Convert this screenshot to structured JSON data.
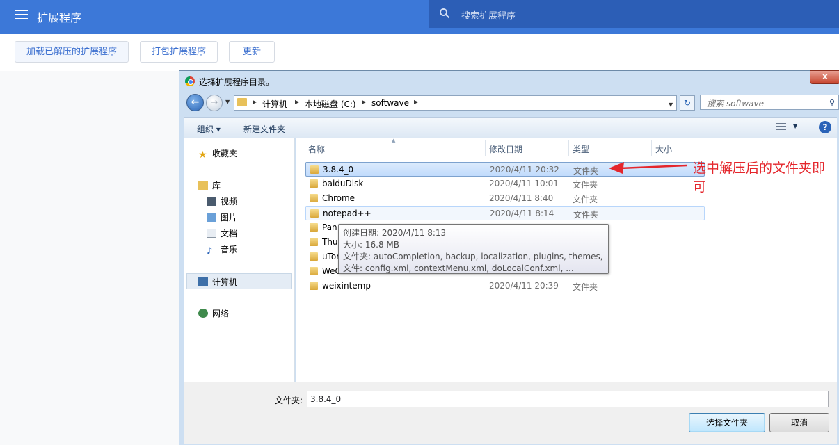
{
  "header": {
    "title": "扩展程序",
    "search_placeholder": "搜索扩展程序"
  },
  "toolbar": {
    "load_unpacked": "加载已解压的扩展程序",
    "pack": "打包扩展程序",
    "update": "更新"
  },
  "dialog": {
    "title": "选择扩展程序目录。",
    "close": "x",
    "breadcrumb": [
      "计算机",
      "本地磁盘 (C:)",
      "softwave"
    ],
    "search_placeholder": "搜索 softwave",
    "commands": {
      "organize": "组织 ▾",
      "new_folder": "新建文件夹"
    },
    "nav_pane": {
      "favorites": "收藏夹",
      "library": "库",
      "videos": "视频",
      "pictures": "图片",
      "documents": "文档",
      "music": "音乐",
      "computer": "计算机",
      "network": "网络"
    },
    "columns": {
      "name": "名称",
      "date": "修改日期",
      "type": "类型",
      "size": "大小"
    },
    "files": [
      {
        "name": "3.8.4_0",
        "date": "2020/4/11 20:32",
        "type": "文件夹"
      },
      {
        "name": "baiduDisk",
        "date": "2020/4/11 10:01",
        "type": "文件夹"
      },
      {
        "name": "Chrome",
        "date": "2020/4/11 8:40",
        "type": "文件夹"
      },
      {
        "name": "notepad++",
        "date": "2020/4/11 8:14",
        "type": "文件夹"
      },
      {
        "name": "Pan",
        "date": "",
        "type": ""
      },
      {
        "name": "Thu",
        "date": "",
        "type": ""
      },
      {
        "name": "uTor",
        "date": "",
        "type": ""
      },
      {
        "name": "WeC",
        "date": "",
        "type": ""
      },
      {
        "name": "weixintemp",
        "date": "2020/4/11 20:39",
        "type": "文件夹"
      }
    ],
    "tooltip": {
      "created": "创建日期: 2020/4/11 8:13",
      "size": "大小: 16.8 MB",
      "folders": "文件夹: autoCompletion, backup, localization, plugins, themes, ...",
      "files": "文件: config.xml, contextMenu.xml, doLocalConf.xml, ..."
    },
    "footer": {
      "folder_label": "文件夹:",
      "folder_value": "3.8.4_0",
      "select_button": "选择文件夹",
      "cancel_button": "取消"
    }
  },
  "annotation": {
    "text": "选中解压后的文件夹即可",
    "color": "#e4262c"
  }
}
